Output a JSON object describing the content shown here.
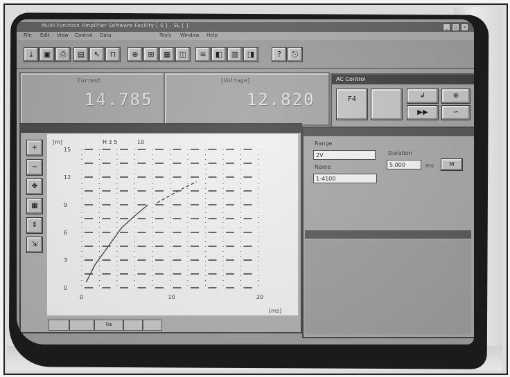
{
  "window": {
    "title": "Multi-function Amplifier Software Facility [ S ] - SL [ ]",
    "buttons": [
      "_",
      "□",
      "x"
    ]
  },
  "menu": [
    "File",
    "Edit",
    "View",
    "Control",
    "Data",
    "Tools",
    "Window",
    "Help"
  ],
  "toolbar_icons": [
    "load-icon",
    "save-icon",
    "print-icon",
    "scope-icon",
    "cursor-icon",
    "measure-icon",
    "zoom-icon",
    "grid-icon",
    "table-icon",
    "fft-icon",
    "filter-icon",
    "sweep-icon",
    "cal-icon",
    "info-icon",
    "help-icon",
    "exit-icon"
  ],
  "readouts": [
    {
      "label": "Current",
      "value": "14.785"
    },
    {
      "label": "[Voltage]",
      "value": "12.820"
    }
  ],
  "control_panel": {
    "title": "AC Control",
    "buttons": [
      "F4",
      "",
      "↲",
      "⊕",
      "▶▶",
      "∽"
    ]
  },
  "graph": {
    "header_labels": [
      "[m]",
      "H 3  5",
      "10"
    ],
    "y_ticks": [
      "15",
      "12",
      "9",
      "6",
      "3",
      "0"
    ],
    "x_ticks": [
      "0",
      "10",
      "20"
    ],
    "x_unit": "[ms]",
    "tabs": [
      "",
      "",
      "Tab",
      "",
      ""
    ]
  },
  "right_panel": {
    "fields": [
      {
        "label": "Range",
        "value": "2V"
      },
      {
        "label": "Name",
        "value": "1-4100"
      },
      {
        "label": "Duration",
        "value": "5.000"
      }
    ],
    "unit": "ms",
    "ok_label": "M"
  },
  "chart_data": {
    "type": "line",
    "xlabel": "[ms]",
    "ylabel": "[m]",
    "xlim": [
      0,
      20
    ],
    "ylim": [
      0,
      15
    ],
    "x_ticks": [
      0,
      10,
      20
    ],
    "y_ticks": [
      0,
      3,
      6,
      9,
      12,
      15
    ],
    "grid": true,
    "series": [
      {
        "values": [
          [
            0.5,
            0.6
          ],
          [
            1.5,
            2.5
          ],
          [
            3,
            4.5
          ],
          [
            4.5,
            6.5
          ],
          [
            6,
            7.8
          ],
          [
            7.5,
            9.0
          ]
        ]
      },
      {
        "values": [
          [
            8.5,
            9.2
          ],
          [
            10,
            10.0
          ],
          [
            11.5,
            10.8
          ],
          [
            13,
            11.5
          ]
        ]
      }
    ]
  }
}
